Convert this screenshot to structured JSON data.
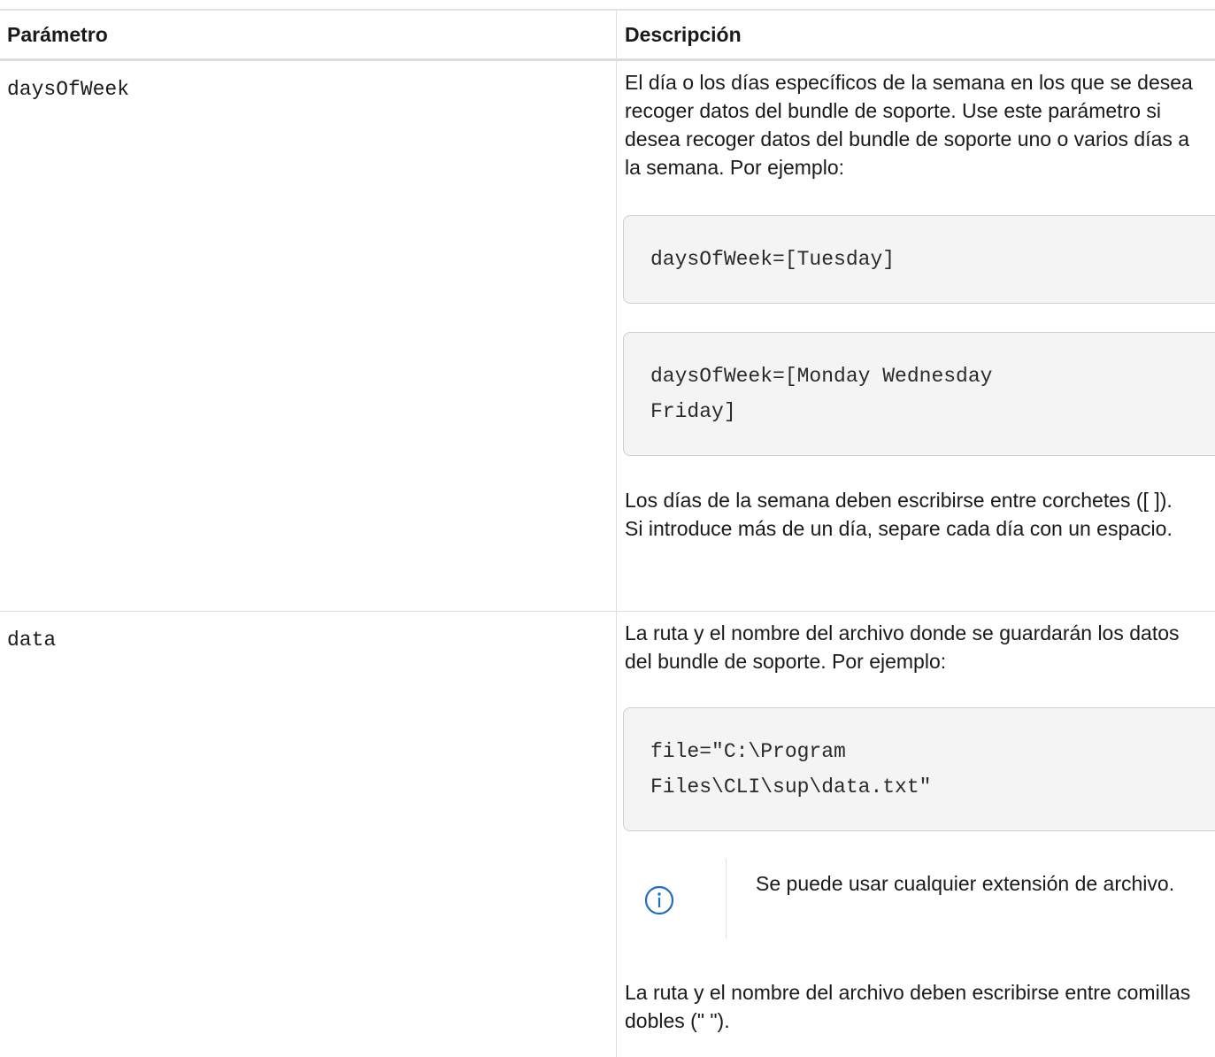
{
  "table": {
    "headers": {
      "parameter": "Parámetro",
      "description": "Descripción"
    },
    "rows": [
      {
        "parameter": "daysOfWeek",
        "description_intro": "El día o los días específicos de la semana en los que se desea recoger datos del bundle de soporte. Use este parámetro si desea recoger datos del bundle de soporte uno o varios días a la semana. Por ejemplo:",
        "examples": [
          {
            "line1": "daysOfWeek=[Tuesday]",
            "line2": ""
          },
          {
            "line1": "daysOfWeek=[Monday Wednesday",
            "line2": "Friday]"
          }
        ],
        "description_outro": "Los días de la semana deben escribirse entre corchetes ([ ]). Si introduce más de un día, separe cada día con un espacio."
      },
      {
        "parameter": "data",
        "description_intro": "La ruta y el nombre del archivo donde se guardarán los datos del bundle de soporte. Por ejemplo:",
        "examples": [
          {
            "line1": "file=\"C:\\Program",
            "line2": "Files\\CLI\\sup\\data.txt\""
          }
        ],
        "note": {
          "icon": "info-icon",
          "text": "Se puede usar cualquier extensión de archivo."
        },
        "description_outro": "La ruta y el nombre del archivo deben escribirse entre comillas dobles (\" \")."
      }
    ]
  },
  "colors": {
    "icon_blue": "#1f6dc4",
    "code_bg": "#f4f4f4"
  }
}
